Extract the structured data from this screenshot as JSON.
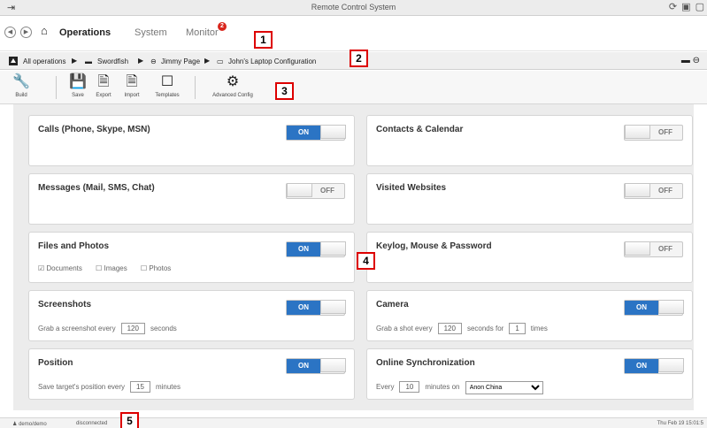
{
  "window": {
    "title": "Remote Control System",
    "controls": "⟳ ▣ ▢"
  },
  "nav": {
    "home_icon": "home-icon",
    "tabs": [
      {
        "label": "Operations"
      },
      {
        "label": "System"
      },
      {
        "label": "Monitor"
      }
    ],
    "monitor_badge": "2"
  },
  "breadcrumb": {
    "items": [
      "All operations",
      "Swordfish",
      "Jimmy Page",
      "John's Laptop Configuration"
    ]
  },
  "toolbar": {
    "build": "Build",
    "save": "Save",
    "export": "Export",
    "import": "Import",
    "templates": "Templates",
    "advanced": "Advanced Config"
  },
  "callouts": [
    "1",
    "2",
    "3",
    "4",
    "5"
  ],
  "modules": {
    "calls": {
      "title": "Calls (Phone, Skype, MSN)",
      "state": "ON"
    },
    "contacts": {
      "title": "Contacts & Calendar",
      "state": "OFF"
    },
    "messages": {
      "title": "Messages (Mail, SMS, Chat)",
      "state": "OFF"
    },
    "websites": {
      "title": "Visited Websites",
      "state": "OFF"
    },
    "files": {
      "title": "Files and Photos",
      "state": "ON",
      "documents": "Documents",
      "images": "Images",
      "photos": "Photos"
    },
    "keylog": {
      "title": "Keylog, Mouse & Password",
      "state": "OFF"
    },
    "screenshots": {
      "title": "Screenshots",
      "state": "ON",
      "prefix": "Grab a screenshot every",
      "value": "120",
      "suffix": "seconds"
    },
    "camera": {
      "title": "Camera",
      "state": "ON",
      "prefix": "Grab a shot every",
      "value": "120",
      "middle": "seconds for",
      "times_value": "1",
      "suffix": "times"
    },
    "position": {
      "title": "Position",
      "state": "ON",
      "prefix": "Save target's position every",
      "value": "15",
      "suffix": "minutes"
    },
    "sync": {
      "title": "Online Synchronization",
      "state": "ON",
      "prefix": "Every",
      "value": "10",
      "middle": "minutes on",
      "network": "Anon China"
    }
  },
  "status": {
    "user": "demo/demo",
    "connection": "disconnected",
    "clock": "Thu Feb 19  15:01:5"
  }
}
